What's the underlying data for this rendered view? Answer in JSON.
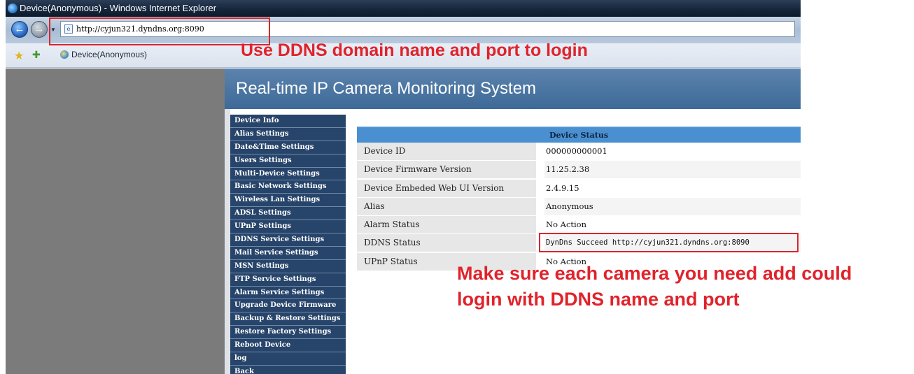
{
  "window": {
    "title": "Device(Anonymous) - Windows Internet Explorer"
  },
  "address_bar": {
    "url": "http://cyjun321.dyndns.org:8090"
  },
  "favorites_bar": {
    "tab_label": "Device(Anonymous)"
  },
  "annotations": {
    "top": "Use DDNS domain name and port to login",
    "bottom_line1": "Make sure each camera you need add could",
    "bottom_line2": "login with DDNS name and port"
  },
  "page": {
    "header_title": "Real-time IP Camera Monitoring System",
    "menu": [
      "Device Info",
      "Alias Settings",
      "Date&Time Settings",
      "Users Settings",
      "Multi-Device Settings",
      "Basic Network Settings",
      "Wireless Lan Settings",
      "ADSL Settings",
      "UPnP Settings",
      "DDNS Service Settings",
      "Mail Service Settings",
      "MSN Settings",
      "FTP Service Settings",
      "Alarm Service Settings",
      "Upgrade Device Firmware",
      "Backup & Restore Settings",
      "Restore Factory Settings",
      "Reboot Device",
      "log",
      "Back"
    ],
    "status": {
      "title": "Device Status",
      "rows": [
        {
          "label": "Device ID",
          "value": "000000000001"
        },
        {
          "label": "Device Firmware Version",
          "value": "11.25.2.38"
        },
        {
          "label": "Device Embeded Web UI Version",
          "value": "2.4.9.15"
        },
        {
          "label": "Alias",
          "value": "Anonymous"
        },
        {
          "label": "Alarm Status",
          "value": "No Action"
        },
        {
          "label": "DDNS Status",
          "value": "DynDns Succeed http://cyjun321.dyndns.org:8090"
        },
        {
          "label": "UPnP Status",
          "value": "No Action"
        }
      ]
    }
  },
  "colors": {
    "annotation_red": "#e0232b",
    "header_blue": "#4b77a3",
    "menu_navy": "#27446a",
    "status_title_blue": "#4a90d0"
  }
}
